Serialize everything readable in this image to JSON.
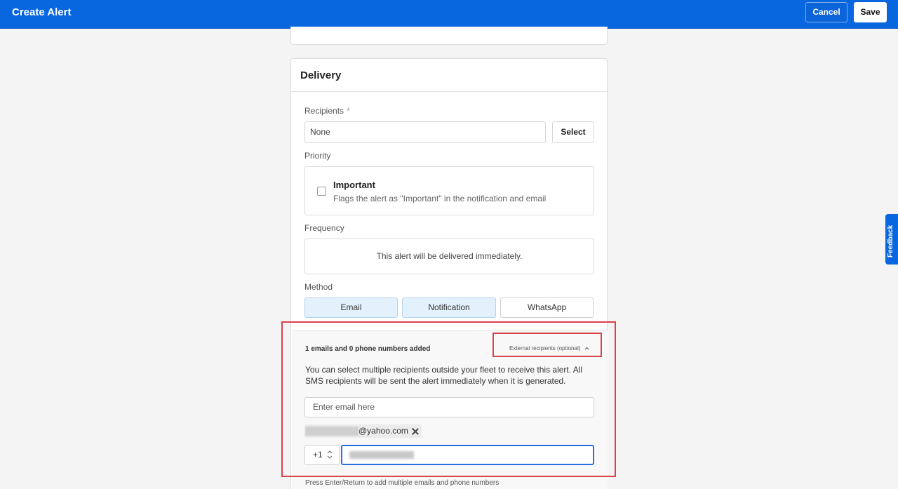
{
  "header": {
    "title": "Create Alert",
    "cancel_label": "Cancel",
    "save_label": "Save"
  },
  "delivery": {
    "title": "Delivery",
    "recipients": {
      "label": "Recipients",
      "required_mark": "*",
      "value": "None",
      "select_label": "Select"
    },
    "priority": {
      "label": "Priority",
      "option_title": "Important",
      "option_desc": "Flags the alert as \"Important\" in the notification and email",
      "checked": false
    },
    "frequency": {
      "label": "Frequency",
      "text": "This alert will be delivered immediately."
    },
    "method": {
      "label": "Method",
      "options": [
        {
          "label": "Email",
          "active": true
        },
        {
          "label": "Notification",
          "active": true
        },
        {
          "label": "WhatsApp",
          "active": false
        }
      ]
    },
    "external": {
      "count_text": "1 emails and 0 phone numbers added",
      "toggle_label": "External recipients (optional)",
      "toggle_icon": "chevron-up-icon",
      "description": "You can select multiple recipients outside your fleet to receive this alert. All SMS recipients will be sent the alert immediately when it is generated.",
      "email_placeholder": "Enter email here",
      "email_chip_domain": "@yahoo.com",
      "country_code": "+1",
      "hint": "Press Enter/Return to add multiple emails and phone numbers"
    }
  },
  "feedback_tab": "Feedback",
  "colors": {
    "brand": "#0866df",
    "highlight": "#d9434a",
    "method_active_bg": "#e3f1fd"
  }
}
